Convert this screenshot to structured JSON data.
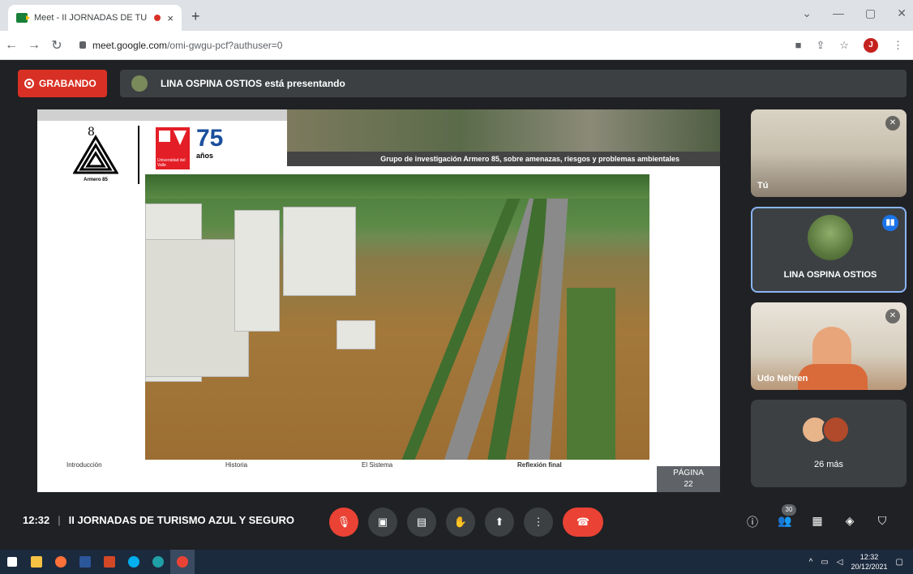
{
  "browser": {
    "tab_title": "Meet - II JORNADAS DE TUR",
    "tab_close": "×",
    "new_tab": "+",
    "url_host": "meet.google.com",
    "url_path": "/omi-gwgu-pcf?authuser=0",
    "profile_initial": "J",
    "window_controls": [
      "⌄",
      "—",
      "▢",
      "✕"
    ]
  },
  "meet": {
    "recording_label": "GRABANDO",
    "presenting_text": "LINA OSPINA OSTIOS está presentando",
    "meeting_time": "12:32",
    "meeting_title": "II JORNADAS DE TURISMO AZUL Y SEGURO",
    "participants_count": "30",
    "more_label": "26 más"
  },
  "slide": {
    "banner_caption": "Grupo de investigación Armero 85, sobre amenazas, riesgos y problemas ambientales",
    "armero_label": "Armero 85",
    "uv_label": "Universidad del Valle",
    "anniv_number": "75",
    "anniv_label": "años",
    "footer": [
      "Introducción",
      "Historia",
      "El Sistema",
      "Reflexión final"
    ],
    "page_label": "PÁGINA",
    "page_number": "22"
  },
  "participants": [
    {
      "name": "Tú"
    },
    {
      "name": "LINA OSPINA OSTIOS"
    },
    {
      "name": "Udo Nehren"
    }
  ],
  "taskbar": {
    "time": "12:32",
    "date": "20/12/2021"
  },
  "colors": {
    "recording_red": "#d93025",
    "active_speaker_border": "#8ab4f8",
    "end_call": "#ea4335"
  }
}
